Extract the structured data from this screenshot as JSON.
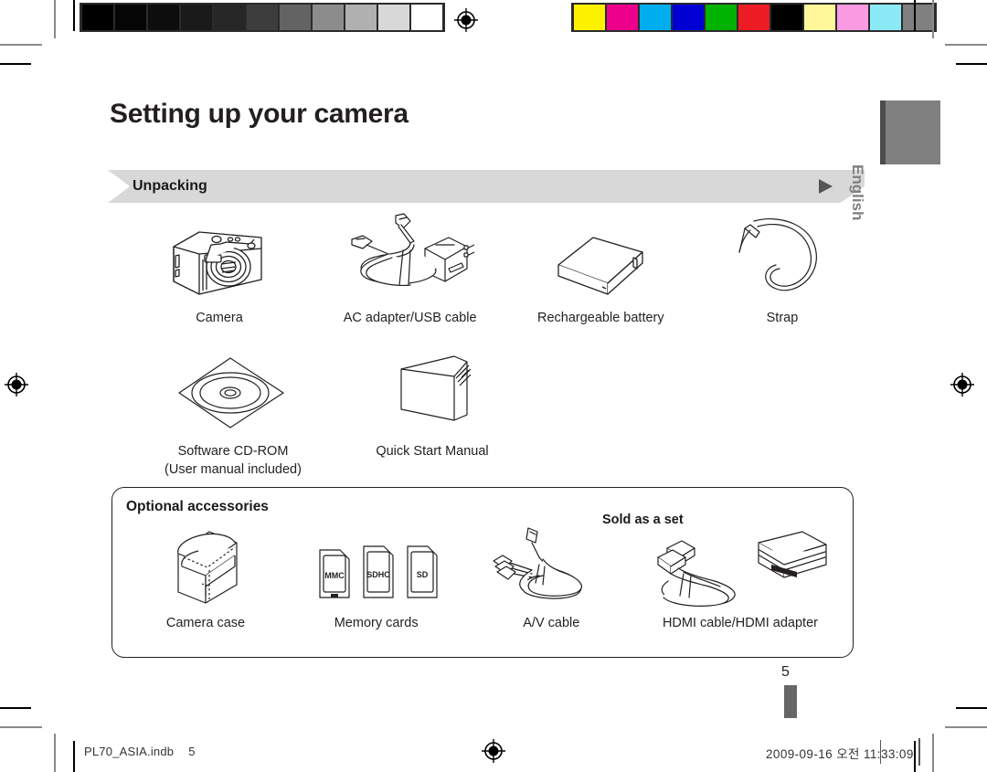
{
  "document": {
    "title": "Setting up your camera",
    "section": "Unpacking",
    "language_tab": "English",
    "page_number": "5"
  },
  "included_items_row1": [
    {
      "label": "Camera",
      "icon": "camera-icon"
    },
    {
      "label": "AC adapter/USB cable",
      "icon": "ac-adapter-usb-cable-icon"
    },
    {
      "label": "Rechargeable battery",
      "icon": "battery-icon"
    },
    {
      "label": "Strap",
      "icon": "strap-icon"
    }
  ],
  "included_items_row2": [
    {
      "label": "Software CD-ROM",
      "sublabel": "(User manual included)",
      "icon": "cd-rom-icon"
    },
    {
      "label": "Quick Start Manual",
      "sublabel": "",
      "icon": "manual-icon"
    }
  ],
  "optional": {
    "title": "Optional accessories",
    "sold_as_set": "Sold as a set",
    "items": [
      {
        "label": "Camera case",
        "icon": "camera-case-icon"
      },
      {
        "label": "Memory cards",
        "icon": "memory-cards-icon"
      },
      {
        "label": "A/V cable",
        "icon": "av-cable-icon"
      },
      {
        "label": "HDMI cable/HDMI adapter",
        "icon": "hdmi-cable-adapter-icon"
      }
    ],
    "memory_card_labels": [
      "MMC",
      "SDHC",
      "SD"
    ]
  },
  "footer": {
    "file_name": "PL70_ASIA.indb",
    "file_page": "5",
    "timestamp": "2009-09-16   오전 11:33:09"
  },
  "calibration": {
    "grayscale_patches": [
      "#000000",
      "#050505",
      "#0d0d0d",
      "#1a1a1a",
      "#262626",
      "#3d3d3d",
      "#636363",
      "#8c8c8c",
      "#b0b0b0",
      "#d8d8d8",
      "#ffffff"
    ],
    "color_patches": [
      "#fff200",
      "#ec008c",
      "#00aeef",
      "#0000d4",
      "#00b200",
      "#ed1c24",
      "#000000",
      "#fff79a",
      "#f99ae3",
      "#8ceaf7",
      "#808080"
    ]
  }
}
